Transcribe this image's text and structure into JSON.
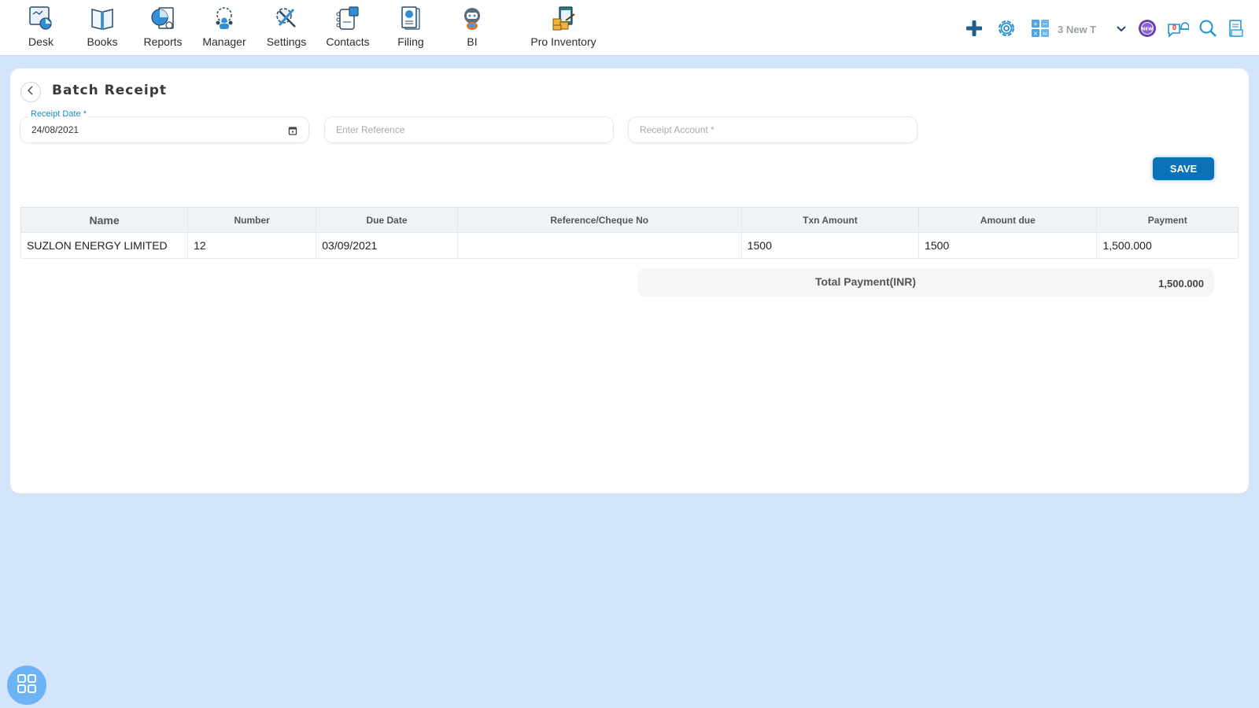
{
  "nav": {
    "items": [
      {
        "label": "Desk",
        "icon": "desk-icon"
      },
      {
        "label": "Books",
        "icon": "books-icon"
      },
      {
        "label": "Reports",
        "icon": "reports-icon"
      },
      {
        "label": "Manager",
        "icon": "manager-icon"
      },
      {
        "label": "Settings",
        "icon": "settings-icon"
      },
      {
        "label": "Contacts",
        "icon": "contacts-icon"
      },
      {
        "label": "Filing",
        "icon": "filing-icon"
      },
      {
        "label": "BI",
        "icon": "bi-robot-icon"
      },
      {
        "label": "Pro Inventory",
        "icon": "pro-inventory-icon"
      }
    ]
  },
  "toolbar": {
    "company_name": "3 New T",
    "notification_count": "0",
    "new_badge": "NEW"
  },
  "page": {
    "title": "Batch Receipt",
    "receipt_date_label": "Receipt Date *",
    "receipt_date_value": "24/08/2021",
    "reference_placeholder": "Enter Reference",
    "receipt_account_placeholder": "Receipt Account *",
    "save_label": "SAVE"
  },
  "table": {
    "columns": [
      "Name",
      "Number",
      "Due Date",
      "Reference/Cheque No",
      "Txn Amount",
      "Amount due",
      "Payment"
    ],
    "rows": [
      {
        "name": "SUZLON ENERGY LIMITED",
        "number": "12",
        "due_date": "03/09/2021",
        "reference": "",
        "txn_amount": "1500",
        "amount_due": "1500",
        "payment": "1,500.000"
      }
    ]
  },
  "total": {
    "label": "Total Payment(INR)",
    "value": "1,500.000"
  },
  "colors": {
    "accent": "#0a72b8",
    "background": "#d3e5fb",
    "label_blue": "#1a8ac9"
  }
}
